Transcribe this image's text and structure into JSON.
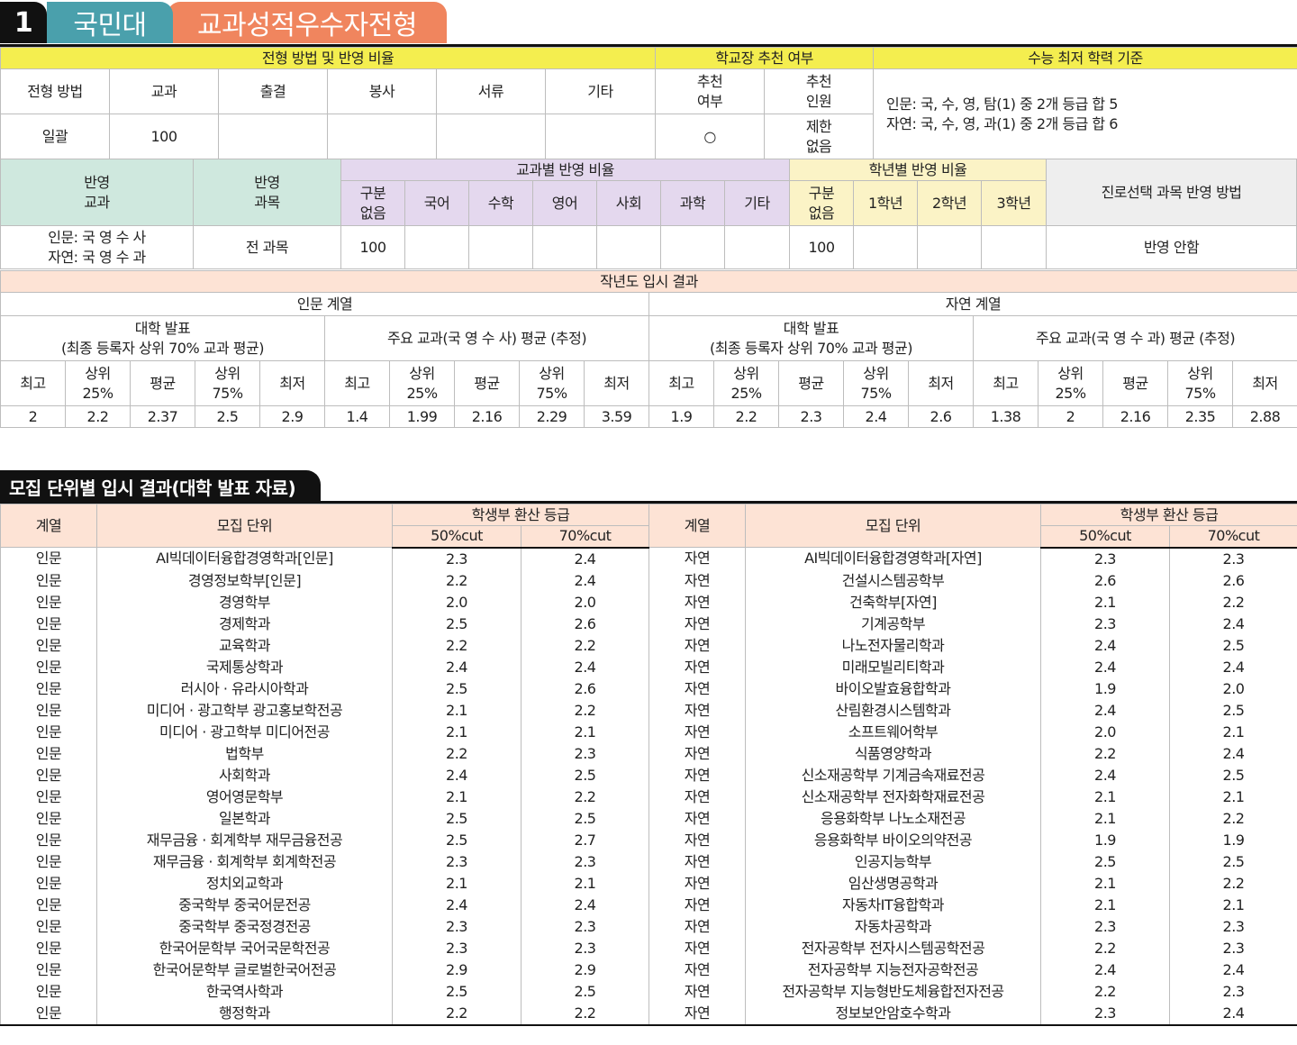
{
  "header": {
    "number": "1",
    "university": "국민대",
    "admission_type": "교과성적우수자전형"
  },
  "method_table": {
    "h_method": "전형 방법 및 반영 비율",
    "h_principal": "학교장 추천 여부",
    "h_min": "수능 최저 학력 기준",
    "cols": [
      "전형 방법",
      "교과",
      "출결",
      "봉사",
      "서류",
      "기타"
    ],
    "rec_yes": [
      "추천",
      "여부"
    ],
    "rec_count": [
      "추천",
      "인원"
    ],
    "values": [
      "일괄",
      "100",
      "",
      "",
      "",
      ""
    ],
    "rec_value": "○",
    "rec_limit": [
      "제한",
      "없음"
    ],
    "min_line1": "인문: 국, 수, 영, 탐(1) 중 2개 등급 합 5",
    "min_line2": "자연: 국, 수, 영, 과(1) 중 2개 등급 합 6"
  },
  "subject_table": {
    "h_subj": [
      "반영",
      "교과"
    ],
    "h_course": [
      "반영",
      "과목"
    ],
    "h_ratio": "교과별 반영 비율",
    "h_grade": "학년별 반영 비율",
    "h_career": "진로선택 과목 반영 방법",
    "nodiv": [
      "구분",
      "없음"
    ],
    "subjects": [
      "국어",
      "수학",
      "영어",
      "사회",
      "과학",
      "기타"
    ],
    "grades": [
      "1학년",
      "2학년",
      "3학년"
    ],
    "subj_line1": "인문: 국 영 수 사",
    "subj_line2": "자연: 국 영 수 과",
    "course": "전 과목",
    "ratio_nodiv": "100",
    "grade_nodiv": "100",
    "career": "반영 안함"
  },
  "results_table": {
    "title": "작년도 입시 결과",
    "humanities": "인문 계열",
    "science": "자연 계열",
    "univ_pub": [
      "대학 발표",
      "(최종 등록자 상위 70% 교과 평균)"
    ],
    "main_hum": "주요 교과(국 영 수 사) 평균 (추정)",
    "main_sci": "주요 교과(국 영 수 과) 평균 (추정)",
    "cols": [
      [
        "최고"
      ],
      [
        "상위",
        "25%"
      ],
      [
        "평균"
      ],
      [
        "상위",
        "75%"
      ],
      [
        "최저"
      ]
    ],
    "values": [
      "2",
      "2.2",
      "2.37",
      "2.5",
      "2.9",
      "1.4",
      "1.99",
      "2.16",
      "2.29",
      "3.59",
      "1.9",
      "2.2",
      "2.3",
      "2.4",
      "2.6",
      "1.38",
      "2",
      "2.16",
      "2.35",
      "2.88"
    ]
  },
  "unit_section": {
    "title": "모집 단위별 입시 결과(대학 발표 자료)",
    "h_field": "계열",
    "h_unit": "모집 단위",
    "h_grade": "학생부 환산 등급",
    "h_50": "50%cut",
    "h_70": "70%cut",
    "rows": [
      [
        "인문",
        "AI빅데이터융합경영학과[인문]",
        "2.3",
        "2.4",
        "자연",
        "AI빅데이터융합경영학과[자연]",
        "2.3",
        "2.3"
      ],
      [
        "인문",
        "경영정보학부[인문]",
        "2.2",
        "2.4",
        "자연",
        "건설시스템공학부",
        "2.6",
        "2.6"
      ],
      [
        "인문",
        "경영학부",
        "2.0",
        "2.0",
        "자연",
        "건축학부[자연]",
        "2.1",
        "2.2"
      ],
      [
        "인문",
        "경제학과",
        "2.5",
        "2.6",
        "자연",
        "기계공학부",
        "2.3",
        "2.4"
      ],
      [
        "인문",
        "교육학과",
        "2.2",
        "2.2",
        "자연",
        "나노전자물리학과",
        "2.4",
        "2.5"
      ],
      [
        "인문",
        "국제통상학과",
        "2.4",
        "2.4",
        "자연",
        "미래모빌리티학과",
        "2.4",
        "2.4"
      ],
      [
        "인문",
        "러시아 · 유라시아학과",
        "2.5",
        "2.6",
        "자연",
        "바이오발효융합학과",
        "1.9",
        "2.0"
      ],
      [
        "인문",
        "미디어 · 광고학부 광고홍보학전공",
        "2.1",
        "2.2",
        "자연",
        "산림환경시스템학과",
        "2.4",
        "2.5"
      ],
      [
        "인문",
        "미디어 · 광고학부 미디어전공",
        "2.1",
        "2.1",
        "자연",
        "소프트웨어학부",
        "2.0",
        "2.1"
      ],
      [
        "인문",
        "법학부",
        "2.2",
        "2.3",
        "자연",
        "식품영양학과",
        "2.2",
        "2.4"
      ],
      [
        "인문",
        "사회학과",
        "2.4",
        "2.5",
        "자연",
        "신소재공학부 기계금속재료전공",
        "2.4",
        "2.5"
      ],
      [
        "인문",
        "영어영문학부",
        "2.1",
        "2.2",
        "자연",
        "신소재공학부 전자화학재료전공",
        "2.1",
        "2.1"
      ],
      [
        "인문",
        "일본학과",
        "2.5",
        "2.5",
        "자연",
        "응용화학부 나노소재전공",
        "2.1",
        "2.2"
      ],
      [
        "인문",
        "재무금융 · 회계학부 재무금융전공",
        "2.5",
        "2.7",
        "자연",
        "응용화학부 바이오의약전공",
        "1.9",
        "1.9"
      ],
      [
        "인문",
        "재무금융 · 회계학부 회계학전공",
        "2.3",
        "2.3",
        "자연",
        "인공지능학부",
        "2.5",
        "2.5"
      ],
      [
        "인문",
        "정치외교학과",
        "2.1",
        "2.1",
        "자연",
        "임산생명공학과",
        "2.1",
        "2.2"
      ],
      [
        "인문",
        "중국학부 중국어문전공",
        "2.4",
        "2.4",
        "자연",
        "자동차IT융합학과",
        "2.1",
        "2.1"
      ],
      [
        "인문",
        "중국학부 중국정경전공",
        "2.3",
        "2.3",
        "자연",
        "자동차공학과",
        "2.3",
        "2.3"
      ],
      [
        "인문",
        "한국어문학부 국어국문학전공",
        "2.3",
        "2.3",
        "자연",
        "전자공학부 전자시스템공학전공",
        "2.2",
        "2.3"
      ],
      [
        "인문",
        "한국어문학부 글로벌한국어전공",
        "2.9",
        "2.9",
        "자연",
        "전자공학부 지능전자공학전공",
        "2.4",
        "2.4"
      ],
      [
        "인문",
        "한국역사학과",
        "2.5",
        "2.5",
        "자연",
        "전자공학부 지능형반도체융합전자전공",
        "2.2",
        "2.3"
      ],
      [
        "인문",
        "행정학과",
        "2.2",
        "2.2",
        "자연",
        "정보보안암호수학과",
        "2.3",
        "2.4"
      ]
    ]
  }
}
